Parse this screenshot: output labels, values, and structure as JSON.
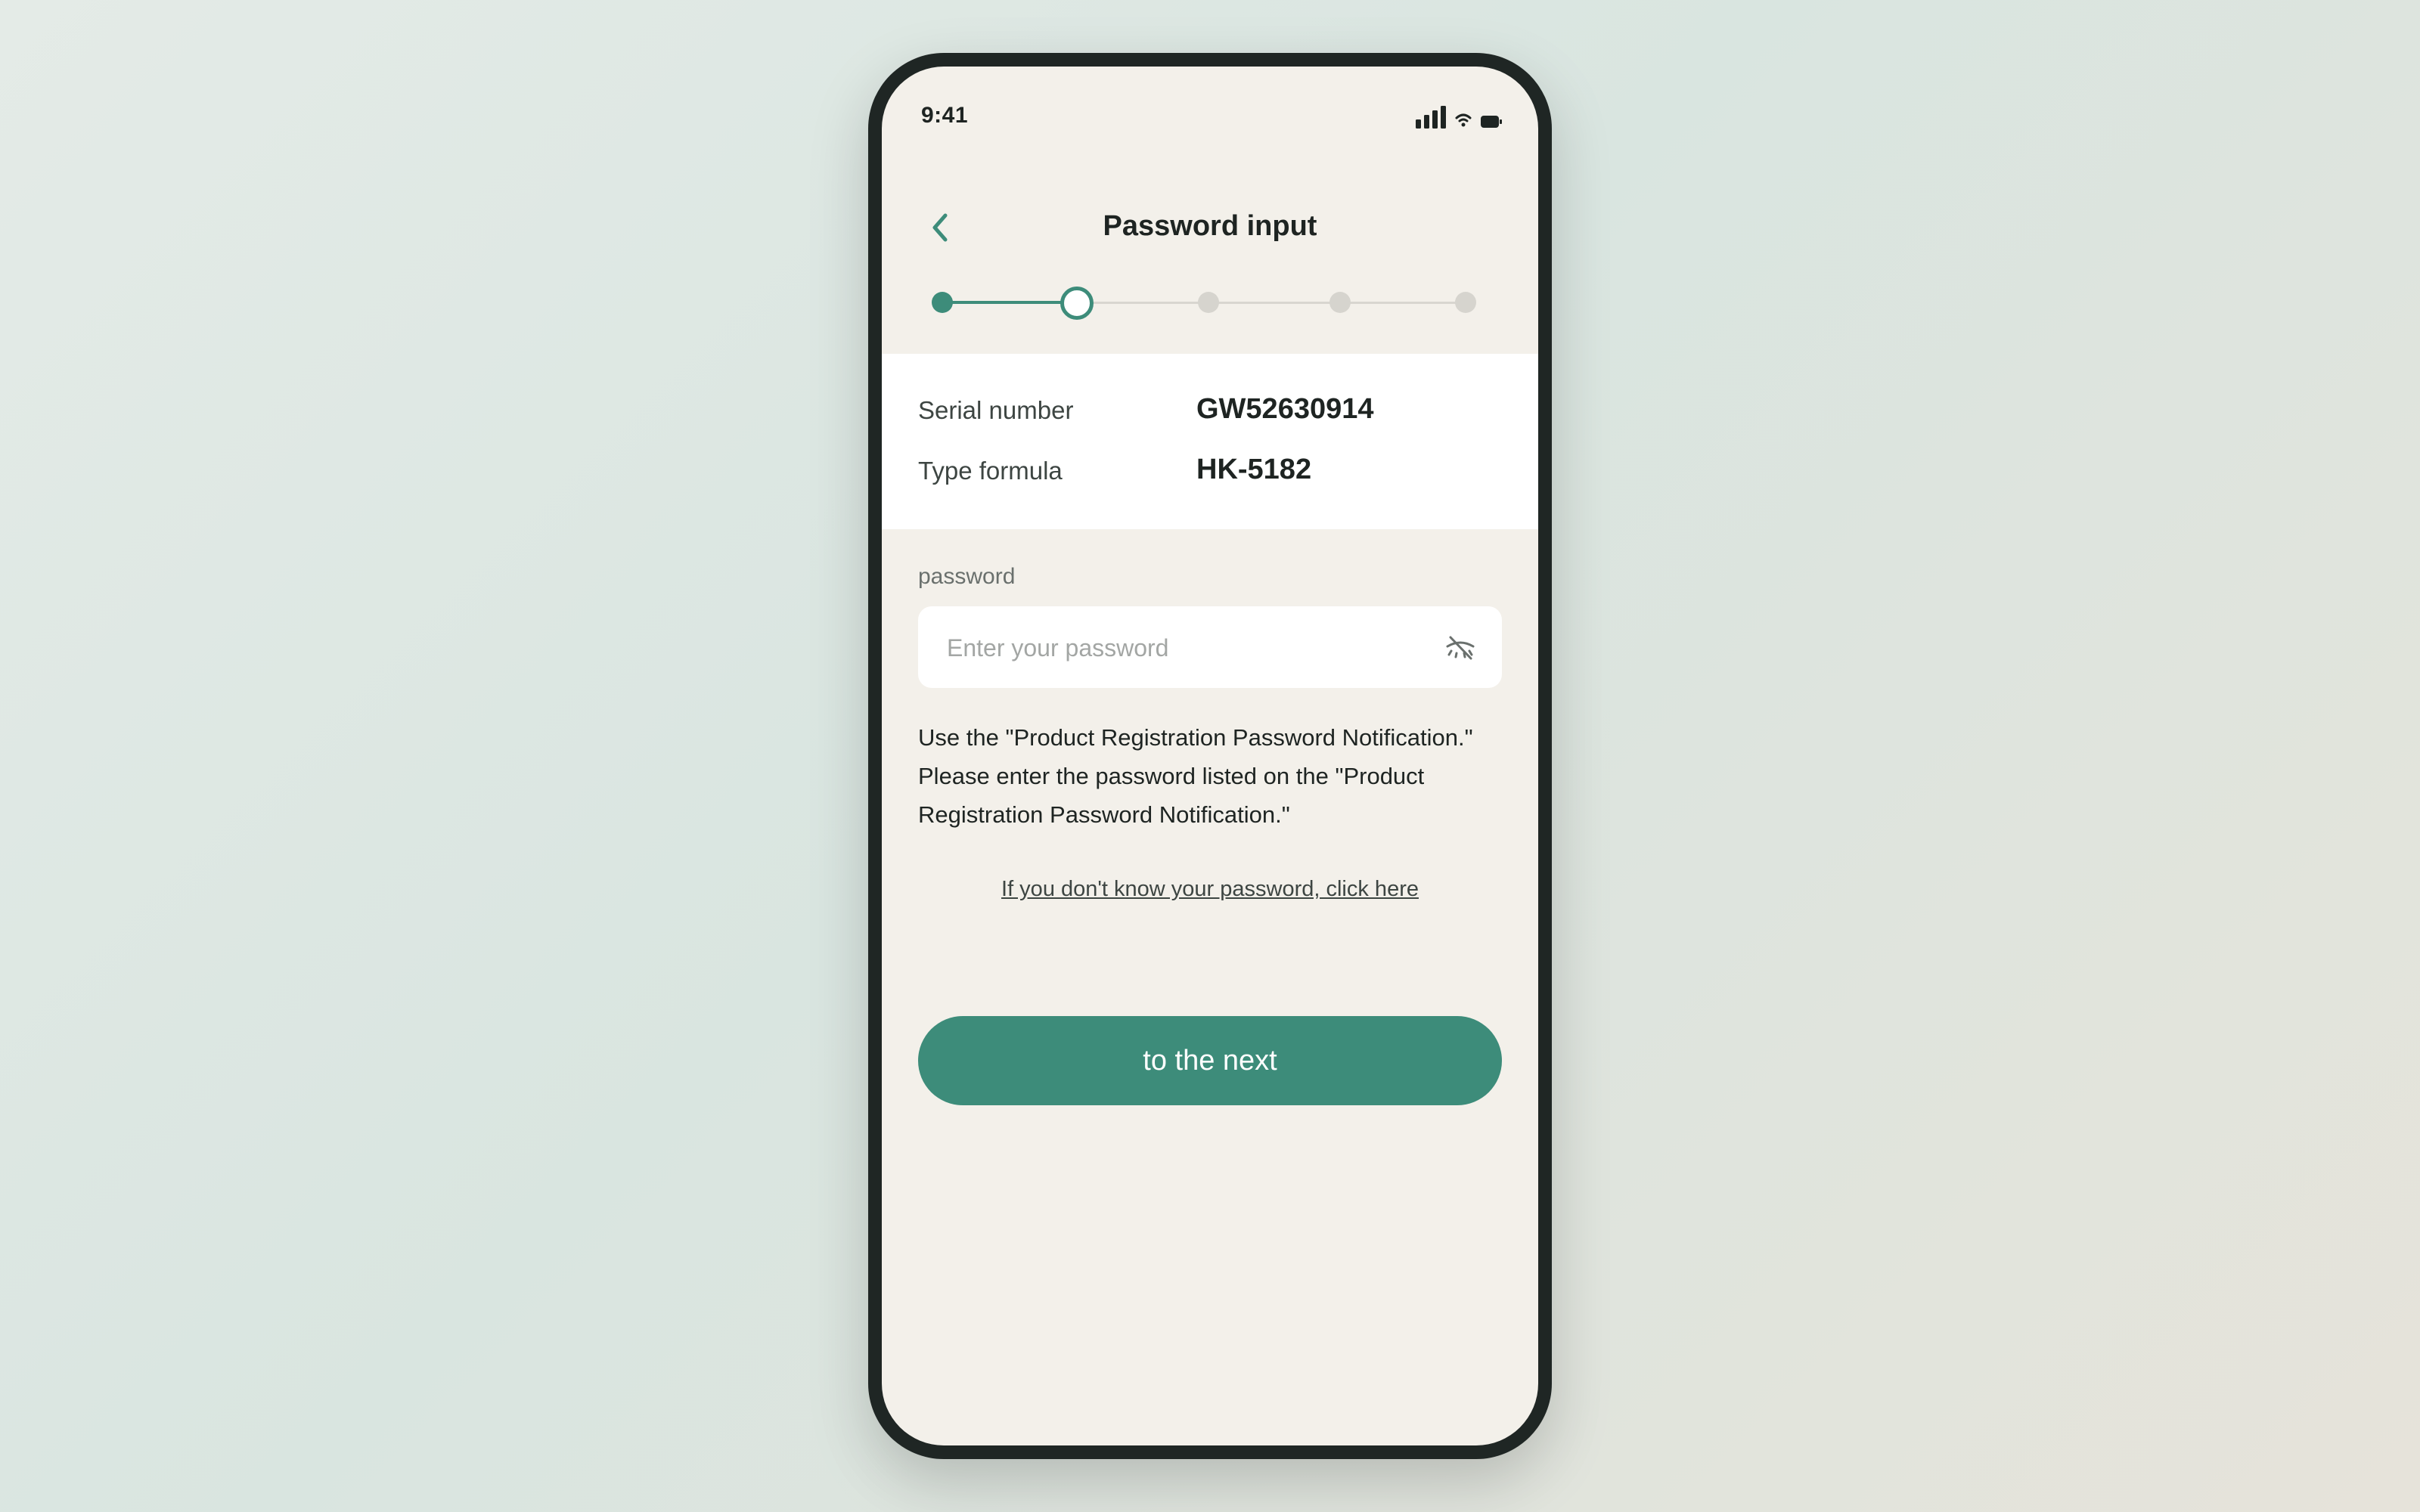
{
  "colors": {
    "accent": "#3d8c7a",
    "screen_background": "#f3f0ea",
    "card_background": "#ffffff",
    "text_primary": "#1e2422",
    "phone_frame": "#1f2624"
  },
  "status_bar": {
    "time": "9:41",
    "icons": [
      "cellular-signal-icon",
      "wifi-icon",
      "battery-icon"
    ]
  },
  "header": {
    "back_icon": "chevron-left-icon",
    "title": "Password input"
  },
  "stepper": {
    "total_steps": 5,
    "current_step": 2
  },
  "product_info": {
    "serial_label": "Serial number",
    "serial_value": "GW52630914",
    "type_label": "Type formula",
    "type_value": "HK-5182"
  },
  "password_field": {
    "label": "password",
    "value": "",
    "placeholder": "Enter your password",
    "toggle_icon": "eye-slash-icon"
  },
  "instructions": "Use the \"Product Registration Password Notification.\" Please enter the password listed on the \"Product Registration Password Notification.\"",
  "help_link": "If you don't know your password, click here",
  "next_button": "to the next"
}
